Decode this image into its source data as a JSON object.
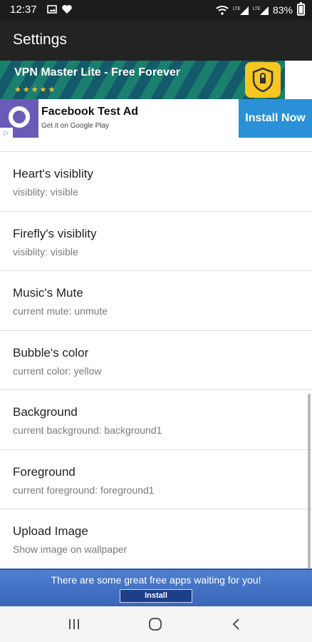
{
  "status_bar": {
    "time": "12:37",
    "battery_percent": "83%",
    "icons_left": [
      "image-icon",
      "heart-icon"
    ],
    "icons_right": [
      "wifi-icon",
      "lte-signal-icon",
      "lte-signal-icon",
      "battery-icon"
    ]
  },
  "app_bar": {
    "title": "Settings"
  },
  "ads": {
    "vpn": {
      "title": "VPN Master Lite - Free Forever",
      "stars": "★★★★★"
    },
    "facebook": {
      "title": "Facebook Test Ad",
      "subtitle": "Get it on Google Play",
      "cta": "Install Now",
      "ad_choices": "▷"
    }
  },
  "settings": [
    {
      "title": "Heart's visiblity",
      "subtitle": "visiblity: visible"
    },
    {
      "title": "Firefly's visiblity",
      "subtitle": "visiblity: visible"
    },
    {
      "title": "Music's Mute",
      "subtitle": "current mute: unmute"
    },
    {
      "title": "Bubble's color",
      "subtitle": "current color: yellow"
    },
    {
      "title": "Background",
      "subtitle": "current background: background1"
    },
    {
      "title": "Foreground",
      "subtitle": "current foreground: foreground1"
    },
    {
      "title": "Upload Image",
      "subtitle": "Show image on wallpaper"
    }
  ],
  "promo": {
    "text": "There are some great free apps waiting for you!",
    "button": "Install"
  },
  "nav": [
    "recents-icon",
    "home-icon",
    "back-icon"
  ],
  "colors": {
    "app_bar": "#232323",
    "install_now": "#2a90d8",
    "promo": "#3a66b8",
    "vpn_shield": "#f7c623"
  }
}
